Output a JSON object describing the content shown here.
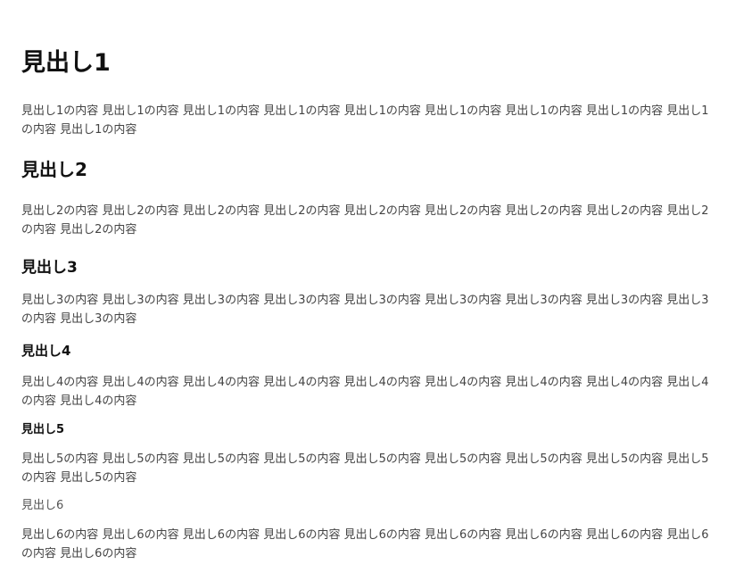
{
  "sections": [
    {
      "heading": "見出し1",
      "body": "見出し1の内容 見出し1の内容 見出し1の内容 見出し1の内容 見出し1の内容 見出し1の内容 見出し1の内容 見出し1の内容 見出し1の内容 見出し1の内容"
    },
    {
      "heading": "見出し2",
      "body": "見出し2の内容 見出し2の内容 見出し2の内容 見出し2の内容 見出し2の内容 見出し2の内容 見出し2の内容 見出し2の内容 見出し2の内容 見出し2の内容"
    },
    {
      "heading": "見出し3",
      "body": "見出し3の内容 見出し3の内容 見出し3の内容 見出し3の内容 見出し3の内容 見出し3の内容 見出し3の内容 見出し3の内容 見出し3の内容 見出し3の内容"
    },
    {
      "heading": "見出し4",
      "body": "見出し4の内容 見出し4の内容 見出し4の内容 見出し4の内容 見出し4の内容 見出し4の内容 見出し4の内容 見出し4の内容 見出し4の内容 見出し4の内容"
    },
    {
      "heading": "見出し5",
      "body": "見出し5の内容 見出し5の内容 見出し5の内容 見出し5の内容 見出し5の内容 見出し5の内容 見出し5の内容 見出し5の内容 見出し5の内容 見出し5の内容"
    },
    {
      "heading": "見出し6",
      "body": "見出し6の内容 見出し6の内容 見出し6の内容 見出し6の内容 見出し6の内容 見出し6の内容 見出し6の内容 見出し6の内容 見出し6の内容 見出し6の内容"
    }
  ]
}
